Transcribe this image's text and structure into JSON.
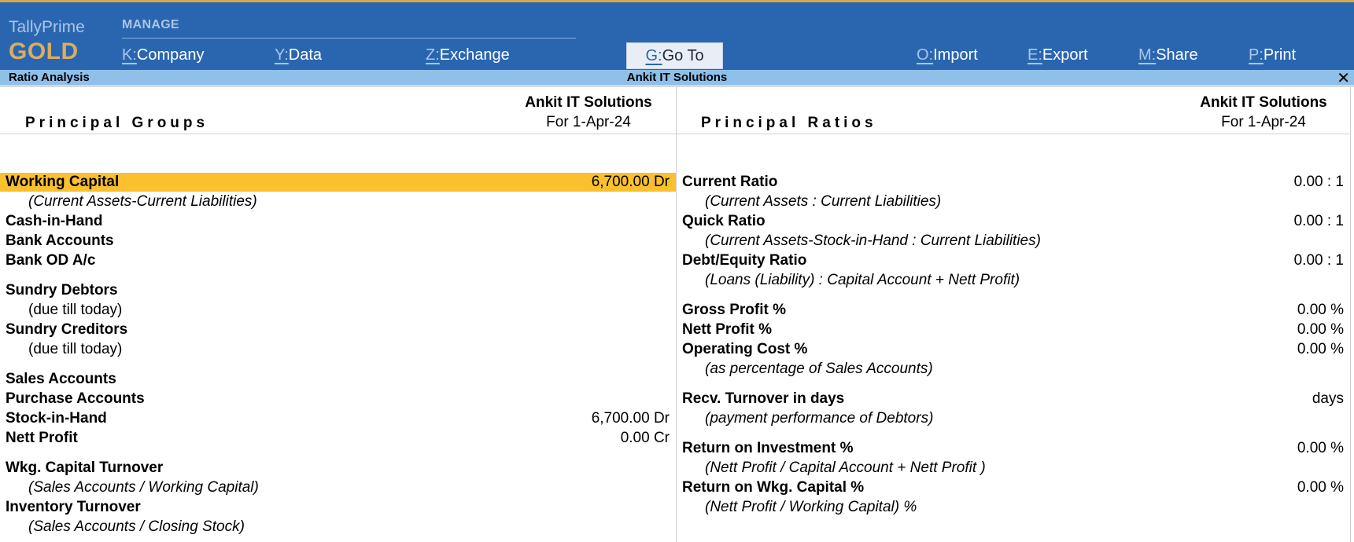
{
  "brand": {
    "name": "TallyPrime",
    "edition": "GOLD"
  },
  "menu": {
    "section_label": "MANAGE",
    "company": {
      "key": "K:",
      "label": "Company"
    },
    "data": {
      "key": "Y:",
      "label": "Data"
    },
    "exchange": {
      "key": "Z:",
      "label": "Exchange"
    },
    "goto": {
      "key": "G:",
      "label": "Go To"
    },
    "import": {
      "key": "O:",
      "label": "Import"
    },
    "export": {
      "key": "E:",
      "label": "Export"
    },
    "share": {
      "key": "M:",
      "label": "Share"
    },
    "print": {
      "key": "P:",
      "label": "Print"
    }
  },
  "titlebar": {
    "report": "Ratio Analysis",
    "company": "Ankit IT Solutions",
    "close_glyph": "✕"
  },
  "left_panel": {
    "title": "Principal Groups",
    "company": "Ankit IT Solutions",
    "period": "For 1-Apr-24",
    "rows": [
      {
        "label": "Working Capital",
        "value": "6,700.00 Dr"
      },
      {
        "label": "(Current Assets-Current Liabilities)",
        "value": ""
      },
      {
        "label": "Cash-in-Hand",
        "value": ""
      },
      {
        "label": "Bank Accounts",
        "value": ""
      },
      {
        "label": "Bank OD A/c",
        "value": ""
      },
      {
        "label": "Sundry Debtors",
        "value": ""
      },
      {
        "label": "(due till today)",
        "value": ""
      },
      {
        "label": "Sundry Creditors",
        "value": ""
      },
      {
        "label": "(due till today)",
        "value": ""
      },
      {
        "label": "Sales Accounts",
        "value": ""
      },
      {
        "label": "Purchase Accounts",
        "value": ""
      },
      {
        "label": "Stock-in-Hand",
        "value": "6,700.00 Dr"
      },
      {
        "label": "Nett Profit",
        "value": "0.00 Cr"
      },
      {
        "label": "Wkg. Capital Turnover",
        "value": ""
      },
      {
        "label": "(Sales Accounts / Working Capital)",
        "value": ""
      },
      {
        "label": "Inventory Turnover",
        "value": ""
      },
      {
        "label": "(Sales Accounts / Closing Stock)",
        "value": ""
      }
    ]
  },
  "right_panel": {
    "title": "Principal Ratios",
    "company": "Ankit IT Solutions",
    "period": "For 1-Apr-24",
    "rows": [
      {
        "label": "Current Ratio",
        "value": "0.00 : 1"
      },
      {
        "label": "(Current Assets : Current Liabilities)",
        "value": ""
      },
      {
        "label": "Quick Ratio",
        "value": "0.00 : 1"
      },
      {
        "label": "(Current Assets-Stock-in-Hand : Current Liabilities)",
        "value": ""
      },
      {
        "label": "Debt/Equity Ratio",
        "value": "0.00 : 1"
      },
      {
        "label": "(Loans (Liability) : Capital Account + Nett Profit)",
        "value": ""
      },
      {
        "label": "Gross Profit %",
        "value": "0.00 %"
      },
      {
        "label": "Nett Profit %",
        "value": "0.00 %"
      },
      {
        "label": "Operating Cost %",
        "value": "0.00 %"
      },
      {
        "label": "(as percentage of Sales Accounts)",
        "value": ""
      },
      {
        "label": "Recv. Turnover in days",
        "value": "days"
      },
      {
        "label": "(payment performance of Debtors)",
        "value": ""
      },
      {
        "label": "Return on Investment %",
        "value": "0.00 %"
      },
      {
        "label": "(Nett Profit / Capital Account + Nett Profit )",
        "value": ""
      },
      {
        "label": "Return on Wkg. Capital %",
        "value": "0.00 %"
      },
      {
        "label": "(Nett Profit / Working Capital) %",
        "value": ""
      }
    ]
  },
  "colors": {
    "topbar": "#2a66b0",
    "titlebar": "#8ec0ea",
    "highlight": "#fbc02d",
    "edition": "#d9ad63"
  }
}
